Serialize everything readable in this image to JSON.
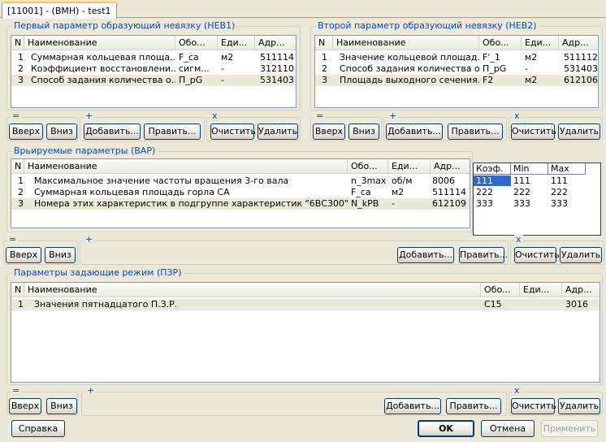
{
  "tab": {
    "label": "[11001] - (ВМН) - test1"
  },
  "neb1": {
    "title": "Первый параметр образующий невязку (НЕВ1)",
    "columns": [
      "N",
      "Наименование",
      "Обо...",
      "Еди...",
      "Адр..."
    ],
    "rows": [
      [
        "1",
        "Суммарная кольцевая площа...",
        "F_ca",
        "м2",
        "511114"
      ],
      [
        "2",
        "Коэффициент восстановлени...",
        "сигм...",
        "-",
        "312110"
      ],
      [
        "3",
        "Способ задания количества о...",
        "П_pG",
        "-",
        "531403"
      ]
    ]
  },
  "neb2": {
    "title": "Второй параметр образующий невязку (НЕВ2)",
    "columns": [
      "N",
      "Наименование",
      "Обо...",
      "Еди...",
      "Адр..."
    ],
    "rows": [
      [
        "1",
        "Значение кольцевой площад...",
        "F'_1",
        "м2",
        "511112"
      ],
      [
        "2",
        "Способ задания количества о...",
        "П_pG",
        "-",
        "531403"
      ],
      [
        "3",
        "Площадь выходного сечения...",
        "F2",
        "м2",
        "612106"
      ]
    ]
  },
  "var": {
    "title": "Врьируемые параметры (ВАР)",
    "columns": [
      "N",
      "Наименование",
      "Обо...",
      "Еди...",
      "Адр..."
    ],
    "rows": [
      [
        "1",
        "Максимальное значение частоты вращения 3-го вала",
        "n_3max",
        "об/м",
        "8006"
      ],
      [
        "2",
        "Суммарная кольцевая площадь горла СА",
        "F_ca",
        "м2",
        "511114"
      ],
      [
        "3",
        "Номера этих характеристик в подгруппе характеристик  \"6ВС300\"",
        "N_kPB",
        "-",
        "612109"
      ]
    ]
  },
  "coef": {
    "columns": [
      "Коэф.",
      "Min",
      "Max"
    ],
    "rows": [
      [
        "111",
        "111",
        "111"
      ],
      [
        "222",
        "222",
        "222"
      ],
      [
        "333",
        "333",
        "333"
      ]
    ]
  },
  "pzr": {
    "title": "Параметры задающие режим (ПЗР)",
    "columns": [
      "N",
      "Наименование",
      "Обо...",
      "Еди...",
      "Адр..."
    ],
    "rows": [
      [
        "1",
        "Значения пятнадцатого П.З.Р.",
        "C15",
        "",
        "3016"
      ]
    ]
  },
  "symbols": {
    "move": "=",
    "add": "+",
    "clear": "x"
  },
  "buttons": {
    "up": "Вверх",
    "down": "Вниз",
    "add": "Добавить...",
    "edit": "Править...",
    "clear": "Очистить",
    "delete": "Удалить"
  },
  "footer": {
    "help": "Справка",
    "ok": "OK",
    "cancel": "Отмена",
    "apply": "Применить"
  }
}
